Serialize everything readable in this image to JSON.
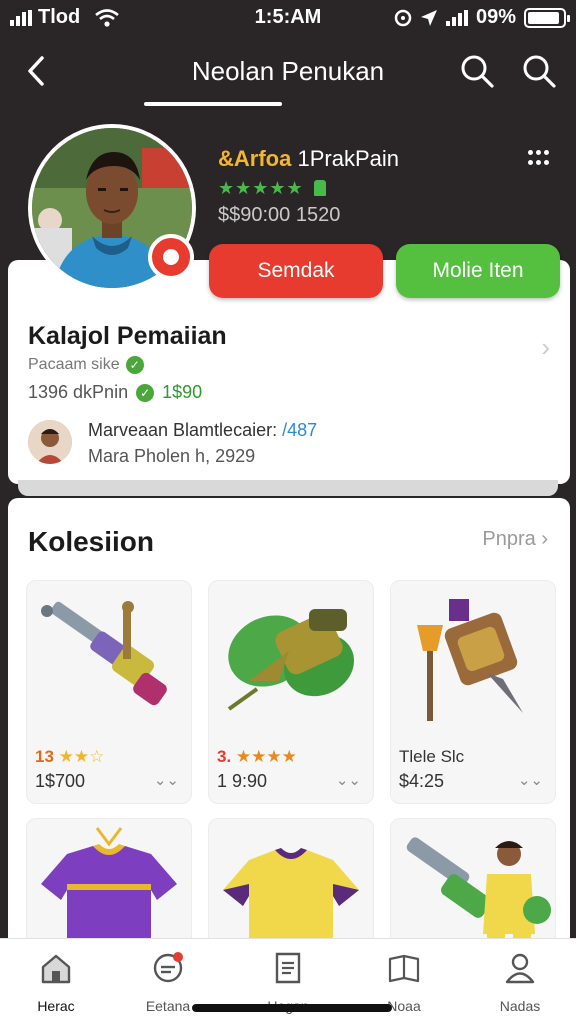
{
  "status_bar": {
    "carrier": "Tlod",
    "time": "1:5:AM",
    "battery_text": "09%",
    "battery_level_percent": 9
  },
  "header": {
    "title": "Neolan Penukan"
  },
  "seller": {
    "name_prefix": "&Arfoa",
    "name": "1PrakPain",
    "rating_stars": "★★★★★",
    "rating_value": 5,
    "price_text": "$$90:00 1520"
  },
  "actions": {
    "primary_label": "Semdak",
    "secondary_label": "Molie Iten",
    "primary_color": "#e63b2e",
    "secondary_color": "#55c040"
  },
  "info": {
    "title": "Kalajol Pemaiian",
    "subtitle": "Pacaam sike",
    "meta_left": "1396 dkPnin",
    "meta_price": "1$90",
    "buyer_line1": "Marveaan Blamtlecaier:",
    "buyer_highlight": "/487",
    "buyer_line2": "Mara Pholen h, 2929"
  },
  "collection": {
    "title": "Kolesiion",
    "link_label": "Pnpra",
    "items": [
      {
        "rating_text": "13",
        "stars": "★★☆",
        "price": "1$700",
        "img": "drill-gun"
      },
      {
        "rating_text": "3.",
        "stars": "★★★★",
        "price": "1 9:90",
        "img": "green-drill"
      },
      {
        "rating_text": "Tlele Slc",
        "stars": "",
        "price": "$4:25",
        "img": "hammer-blade"
      },
      {
        "img": "purple-jersey"
      },
      {
        "img": "yellow-jersey"
      },
      {
        "img": "player-with-drill"
      }
    ]
  },
  "bottom_nav": {
    "items": [
      {
        "label": "Herac",
        "icon": "home-icon"
      },
      {
        "label": "Eetana",
        "icon": "chat-icon"
      },
      {
        "label": "Hogan",
        "icon": "document-icon"
      },
      {
        "label": "Noaa",
        "icon": "book-icon"
      },
      {
        "label": "Nadas",
        "icon": "profile-icon"
      }
    ]
  }
}
